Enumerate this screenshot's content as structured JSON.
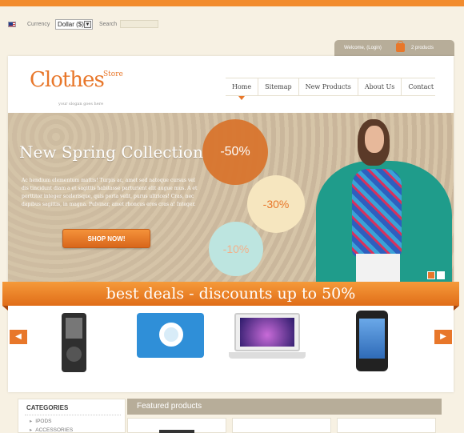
{
  "utility": {
    "flag_icon": "us-flag-icon",
    "currency_label": "Currency",
    "currency_value": "Dollar ($)",
    "search_label": "Search",
    "search_value": ""
  },
  "account": {
    "welcome": "Welcome, (Login)",
    "basket_icon": "basket-icon",
    "cart_count": "2 products"
  },
  "logo": {
    "name": "Clothes",
    "store": "Store",
    "slogan": "your slogan goes here"
  },
  "nav": {
    "items": [
      {
        "label": "Home",
        "active": true
      },
      {
        "label": "Sitemap"
      },
      {
        "label": "New Products"
      },
      {
        "label": "About Us"
      },
      {
        "label": "Contact"
      }
    ]
  },
  "hero": {
    "title": "New Spring Collection",
    "text": "Ac hendium elementum mattis! Turpis ac, amet sed natoque cursus vel dis tincidunt diam a et sagittis habitasse parturient elit augue mus. A et porttitor integer scelerisque, quis porta velit, purus ultrices! Cras, nec dapibus sagittis, in magna. Pulvinar, amet rhoncus eros cras a! Integer.",
    "button_label": "SHOP NOW!",
    "discounts": [
      "-50%",
      "-30%",
      "-10%"
    ],
    "slide_dots": [
      "#e8772a",
      "#ffffff"
    ]
  },
  "deals": {
    "banner": "best deals - discounts up to 50%",
    "prev_icon": "arrow-left-icon",
    "next_icon": "arrow-right-icon",
    "products": [
      "ipod-image",
      "ipod-shuffle-image",
      "laptop-image",
      "iphone-image"
    ]
  },
  "sidebar": {
    "heading": "CATEGORIES",
    "items": [
      "IPODS",
      "ACCESSORIES"
    ]
  },
  "featured": {
    "heading": "Featured products"
  },
  "colors": {
    "accent": "#e8772a",
    "tab": "#b7ad99",
    "background": "#f7f1e3"
  }
}
